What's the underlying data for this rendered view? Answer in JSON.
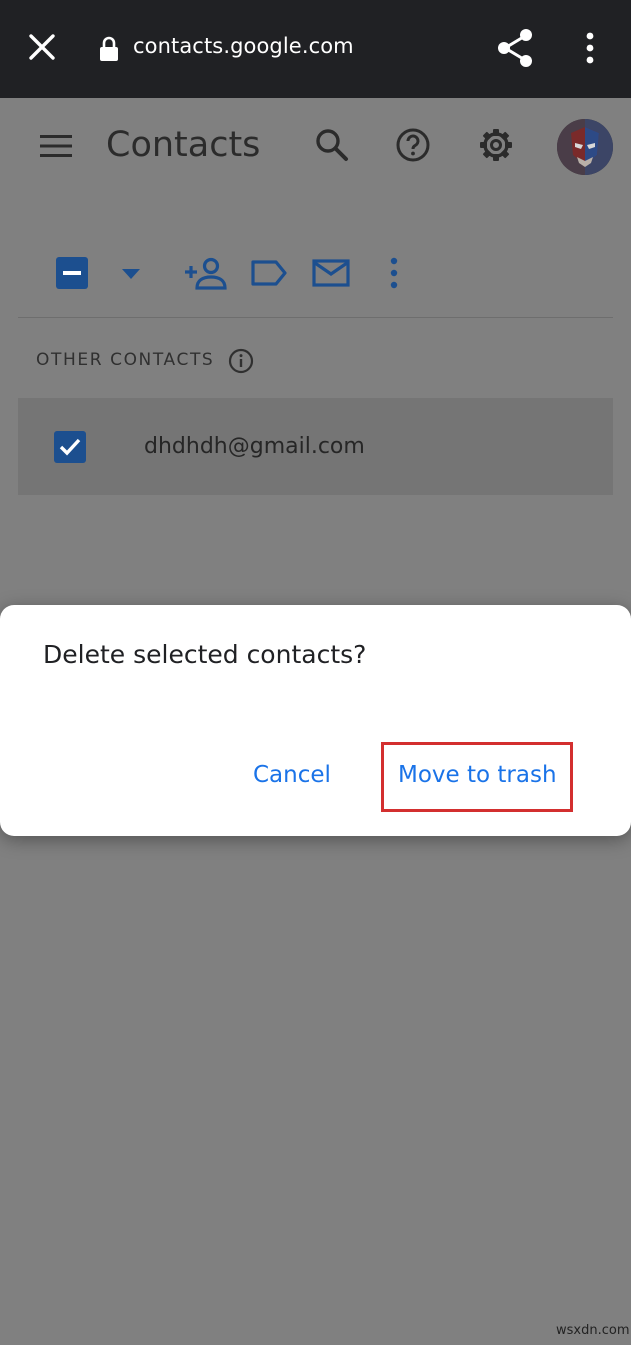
{
  "browser": {
    "url": "contacts.google.com",
    "icons": [
      "close-icon",
      "lock-icon",
      "share-icon",
      "more-vert-icon"
    ]
  },
  "app": {
    "title": "Contacts",
    "icons": [
      "menu-icon",
      "search-icon",
      "help-icon",
      "settings-icon"
    ]
  },
  "toolbar": {
    "icons": [
      "indeterminate-checkbox-icon",
      "caret-down-icon",
      "add-person-icon",
      "label-icon",
      "mail-icon",
      "more-vert-icon"
    ]
  },
  "section": {
    "label": "OTHER CONTACTS"
  },
  "contacts": [
    {
      "email": "dhdhdh@gmail.com",
      "selected": true
    }
  ],
  "dialog": {
    "title": "Delete selected contacts?",
    "cancel_label": "Cancel",
    "confirm_label": "Move to trash"
  },
  "colors": {
    "chrome_bg": "#202124",
    "scrim_bg": "#808080",
    "accent": "#1a73e8",
    "highlight_box": "#d32f2f"
  },
  "watermark": "wsxdn.com"
}
